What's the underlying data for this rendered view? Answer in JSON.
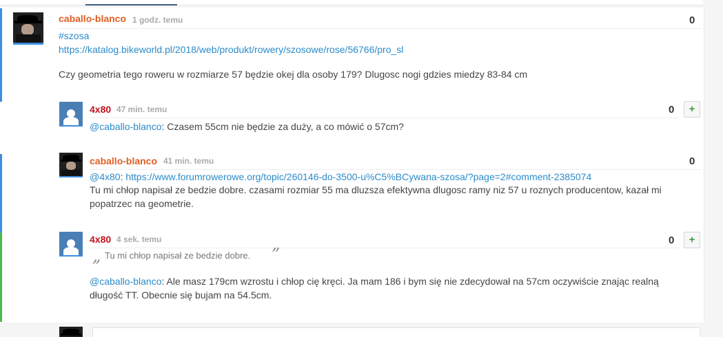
{
  "colors": {
    "accent_blue": "#2b8bc9",
    "author_orange": "#e05e24",
    "author_red": "#c0121c",
    "vote_plus_green": "#3f9a3f",
    "left_bar_blue": "#3c8dde",
    "left_bar_green": "#4cb84c"
  },
  "entry": {
    "author": "caballo-blanco",
    "time": "1 godz. temu",
    "votes": "0",
    "tag": "#szosa",
    "url": "https://katalog.bikeworld.pl/2018/web/produkt/rowery/szosowe/rose/56766/pro_sl",
    "body": "Czy geometria tego roweru w rozmiarze 57 będzie okej dla osoby 179? Dlugosc nogi gdzies miedzy 83-84 cm",
    "avatar_icon": "user-avatar-icon"
  },
  "comments": [
    {
      "author": "4x80",
      "time": "47 min. temu",
      "votes": "0",
      "plus": "+",
      "mention": "@caballo-blanco",
      "mention_suffix": ": Czasem 55cm nie będzie za duży, a co mówić o 57cm?"
    },
    {
      "author": "caballo-blanco",
      "time": "41 min. temu",
      "votes": "0",
      "mention": "@4x80",
      "mention_sep": ": ",
      "url": "https://www.forumrowerowe.org/topic/260146-do-3500-u%C5%BCywana-szosa/?page=2#comment-2385074",
      "line1": "Tu mi chłop napisał ze bedzie dobre. czasami rozmiar 55 ma dluzsza efektywna dlugosc ramy niz 57 u roznych producentow, kazał mi",
      "line2": "popatrzec na geometrie."
    },
    {
      "author": "4x80",
      "time": "4 sek. temu",
      "votes": "0",
      "plus": "+",
      "quote_open": "„",
      "quote": "Tu mi chłop napisał ze bedzie dobre.",
      "quote_close": "”",
      "mention": "@caballo-blanco",
      "line1": ": Ale masz 179cm wzrostu i chłop cię kręci. Ja mam 186 i bym się nie zdecydował na 57cm oczywiście znając realną",
      "line2": "długość TT. Obecnie się bujam na 54.5cm."
    }
  ]
}
